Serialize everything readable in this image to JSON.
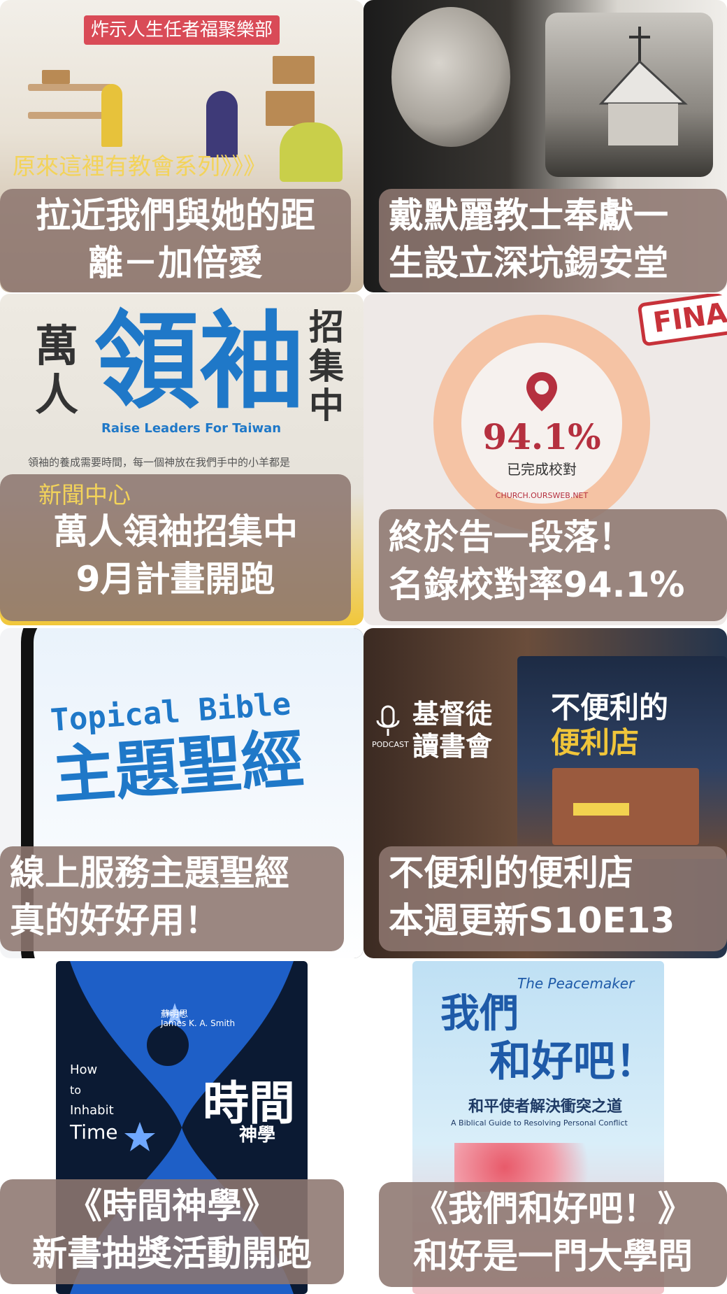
{
  "tiles": [
    {
      "tag": "原來這裡有教會系列》》》",
      "banner": "炸示人生任者福聚樂部",
      "caption": [
        "拉近我們與她的距",
        "離－加倍愛"
      ]
    },
    {
      "caption": [
        "戴默麗教士奉獻一",
        "生設立深坑錫安堂"
      ]
    },
    {
      "poster": {
        "word_left": "萬人",
        "word_main": "領袖",
        "word_right": "招集中",
        "subtitle_en": "Raise Leaders For Taiwan",
        "body": "領袖的養成需要時間，每一個神放在我們手中的小羊都是"
      },
      "tag": "新聞中心",
      "caption": [
        "萬人領袖招集中",
        "9月計畫開跑"
      ]
    },
    {
      "stamp": "FINAL",
      "progress_percent": 94.1,
      "progress_text": "94.1%",
      "progress_label": "已完成校對",
      "site": "CHURCH.OURSWEB.NET",
      "caption": [
        "終於告一段落！",
        "名錄校對率94.1%"
      ]
    },
    {
      "app_title_en": "Topical Bible",
      "app_title_zh": "主題聖經",
      "caption": [
        "線上服務主題聖經",
        "真的好好用！"
      ]
    },
    {
      "podcast_label": "PODCAST",
      "podcast_title": [
        "基督徒",
        "讀書會"
      ],
      "book_title": [
        "不便利的",
        "便利店"
      ],
      "caption": [
        "不便利的便利店",
        "本週更新S10E13"
      ]
    },
    {
      "book": {
        "authors": [
          "蘇明思",
          "James K. A. Smith"
        ],
        "en_title": [
          "How",
          "to",
          "Inhabit",
          "Time"
        ],
        "zh_title": "時間",
        "zh_sub": "神學",
        "spine": "時間神學"
      },
      "caption": [
        "《時間神學》",
        "新書抽獎活動開跑"
      ]
    },
    {
      "book": {
        "zh_title": [
          "我們",
          "和好吧！"
        ],
        "en_title": "The Peacemaker",
        "subtitle": "和平使者解決衝突之道",
        "subtitle_en": "A Biblical Guide to Resolving Personal Conflict"
      },
      "caption": [
        "《我們和好吧！》",
        "和好是一門大學問"
      ]
    }
  ],
  "colors": {
    "caption_bg": "#8d7670",
    "tag_text": "#f3d35a",
    "ring_fill": "#f5c3a4",
    "accent_red": "#b5303f",
    "bible_blue": "#1f78c8"
  }
}
